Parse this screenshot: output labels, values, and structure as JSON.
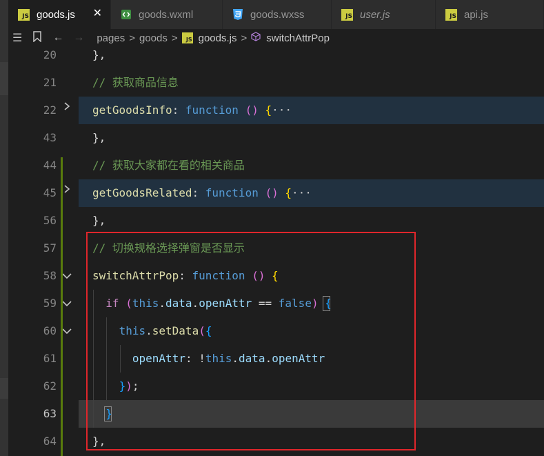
{
  "tabs": [
    {
      "label": "goods.js",
      "icon": "js-file-icon",
      "active": true,
      "close": "✕"
    },
    {
      "label": "goods.wxml",
      "icon": "wxml-file-icon"
    },
    {
      "label": "goods.wxss",
      "icon": "css-file-icon"
    },
    {
      "label": "user.js",
      "icon": "js-file-icon",
      "italic": true
    },
    {
      "label": "api.js",
      "icon": "js-file-icon"
    }
  ],
  "breadcrumb": {
    "back": "←",
    "forward": "→",
    "items": [
      "pages",
      "goods",
      "goods.js",
      "switchAttrPop"
    ],
    "separator": ">"
  },
  "editor": {
    "lines": [
      {
        "num": "20",
        "tokens": [
          [
            "},",
            "punc"
          ]
        ]
      },
      {
        "num": "21",
        "tokens": [
          [
            "// 获取商品信息",
            "comment"
          ]
        ]
      },
      {
        "num": "22",
        "fold": "collapsed",
        "tokens": [
          [
            "getGoodsInfo",
            "prop"
          ],
          [
            ": ",
            "punc"
          ],
          [
            "function",
            "kw"
          ],
          [
            " ",
            "punc"
          ],
          [
            "()",
            "paren"
          ],
          [
            " ",
            "punc"
          ],
          [
            "{",
            "brace"
          ],
          [
            "···",
            "dots"
          ]
        ]
      },
      {
        "num": "43",
        "tokens": [
          [
            "},",
            "punc"
          ]
        ]
      },
      {
        "num": "44",
        "tokens": [
          [
            "// 获取大家都在看的相关商品",
            "comment"
          ]
        ]
      },
      {
        "num": "45",
        "fold": "collapsed",
        "tokens": [
          [
            "getGoodsRelated",
            "prop"
          ],
          [
            ": ",
            "punc"
          ],
          [
            "function",
            "kw"
          ],
          [
            " ",
            "punc"
          ],
          [
            "()",
            "paren"
          ],
          [
            " ",
            "punc"
          ],
          [
            "{",
            "brace"
          ],
          [
            "···",
            "dots"
          ]
        ]
      },
      {
        "num": "56",
        "tokens": [
          [
            "},",
            "punc"
          ]
        ]
      },
      {
        "num": "57",
        "tokens": [
          [
            "// 切换规格选择弹窗是否显示",
            "comment"
          ]
        ]
      },
      {
        "num": "58",
        "fold": "expanded",
        "tokens": [
          [
            "switchAttrPop",
            "prop"
          ],
          [
            ": ",
            "punc"
          ],
          [
            "function",
            "kw"
          ],
          [
            " ",
            "punc"
          ],
          [
            "()",
            "paren"
          ],
          [
            " ",
            "punc"
          ],
          [
            "{",
            "brace"
          ]
        ]
      },
      {
        "num": "59",
        "fold": "expanded",
        "indent": 1,
        "tokens": [
          [
            "if",
            "ctrl"
          ],
          [
            " ",
            "punc"
          ],
          [
            "(",
            "paren"
          ],
          [
            "this",
            "kw"
          ],
          [
            ".",
            "punc"
          ],
          [
            "data",
            "var"
          ],
          [
            ".",
            "punc"
          ],
          [
            "openAttr",
            "var"
          ],
          [
            " == ",
            "punc"
          ],
          [
            "false",
            "kw"
          ],
          [
            ")",
            "paren"
          ],
          [
            " ",
            "punc"
          ],
          [
            "{",
            "paren2"
          ]
        ]
      },
      {
        "num": "60",
        "fold": "expanded",
        "indent": 2,
        "tokens": [
          [
            "this",
            "kw"
          ],
          [
            ".",
            "punc"
          ],
          [
            "setData",
            "func"
          ],
          [
            "(",
            "paren"
          ],
          [
            "{",
            "paren2"
          ]
        ]
      },
      {
        "num": "61",
        "indent": 3,
        "tokens": [
          [
            "openAttr",
            "var"
          ],
          [
            ": ",
            "punc"
          ],
          [
            "!",
            "punc"
          ],
          [
            "this",
            "kw"
          ],
          [
            ".",
            "punc"
          ],
          [
            "data",
            "var"
          ],
          [
            ".",
            "punc"
          ],
          [
            "openAttr",
            "var"
          ]
        ]
      },
      {
        "num": "62",
        "indent": 2,
        "tokens": [
          [
            "}",
            "paren2"
          ],
          [
            ")",
            "paren"
          ],
          [
            ";",
            "punc"
          ]
        ]
      },
      {
        "num": "63",
        "indent": 1,
        "current": true,
        "tokens": [
          [
            "}",
            "paren2"
          ]
        ]
      },
      {
        "num": "64",
        "tokens": [
          [
            "},",
            "punc"
          ]
        ]
      }
    ]
  },
  "colors": {
    "highlight_box": "#e0262b",
    "git_modified": "#587c0c",
    "comment": "#6a9955",
    "keyword": "#569cd6"
  }
}
